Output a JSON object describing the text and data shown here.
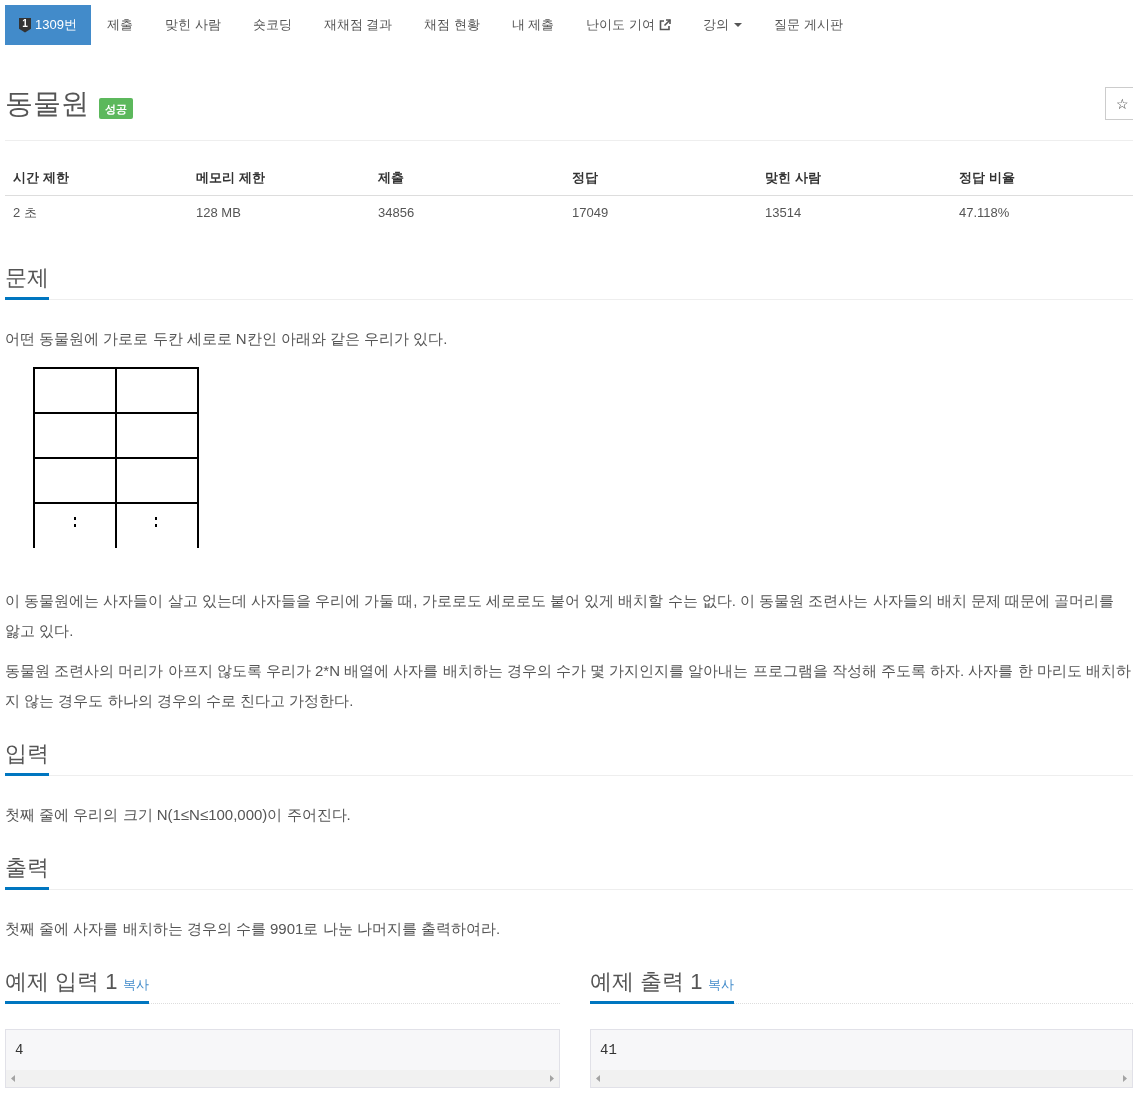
{
  "nav": {
    "tabs": [
      {
        "kind": "problem",
        "badge": "1",
        "label": "1309번",
        "selected": true
      },
      {
        "kind": "link",
        "label": "제출",
        "selected": false
      },
      {
        "kind": "link",
        "label": "맞힌 사람",
        "selected": false
      },
      {
        "kind": "link",
        "label": "숏코딩",
        "selected": false
      },
      {
        "kind": "link",
        "label": "재채점 결과",
        "selected": false
      },
      {
        "kind": "link",
        "label": "채점 현황",
        "selected": false
      },
      {
        "kind": "link",
        "label": "내 제출",
        "selected": false
      },
      {
        "kind": "external",
        "label": "난이도 기여",
        "selected": false
      },
      {
        "kind": "dropdown",
        "label": "강의",
        "selected": false
      },
      {
        "kind": "link",
        "label": "질문 게시판",
        "selected": false
      }
    ]
  },
  "header": {
    "title": "동물원",
    "status_label": "성공",
    "star_button": "☆"
  },
  "info_table": {
    "columns": [
      "시간 제한",
      "메모리 제한",
      "제출",
      "정답",
      "맞힌 사람",
      "정답 비율"
    ],
    "rows": [
      [
        "2 초",
        "128 MB",
        "34856",
        "17049",
        "13514",
        "47.118%"
      ]
    ]
  },
  "sections": [
    {
      "heading": "문제",
      "blocks": [
        {
          "kind": "paragraph",
          "text": "어떤 동물원에 가로로 두칸 세로로 N칸인 아래와 같은 우리가 있다."
        },
        {
          "kind": "figure"
        },
        {
          "kind": "paragraph",
          "text": "이 동물원에는 사자들이 살고 있는데 사자들을 우리에 가둘 때, 가로로도 세로로도 붙어 있게 배치할 수는 없다. 이 동물원 조련사는 사자들의 배치 문제 때문에 골머리를 앓고 있다."
        },
        {
          "kind": "paragraph",
          "text": "동물원 조련사의 머리가 아프지 않도록 우리가 2*N 배열에 사자를 배치하는 경우의 수가 몇 가지인지를 알아내는 프로그램을 작성해 주도록 하자. 사자를 한 마리도 배치하지 않는 경우도 하나의 경우의 수로 친다고 가정한다."
        }
      ]
    },
    {
      "heading": "입력",
      "blocks": [
        {
          "kind": "paragraph",
          "text": "첫째 줄에 우리의 크기 N(1≤N≤100,000)이 주어진다."
        }
      ]
    },
    {
      "heading": "출력",
      "blocks": [
        {
          "kind": "paragraph",
          "text": "첫째 줄에 사자를 배치하는 경우의 수를 9901로 나눈 나머지를 출력하여라."
        }
      ]
    }
  ],
  "samples": [
    {
      "heading": "예제 입력 1",
      "copy_link": "복사",
      "content": "4"
    },
    {
      "heading": "예제 출력 1",
      "copy_link": "복사",
      "content": "41"
    }
  ]
}
